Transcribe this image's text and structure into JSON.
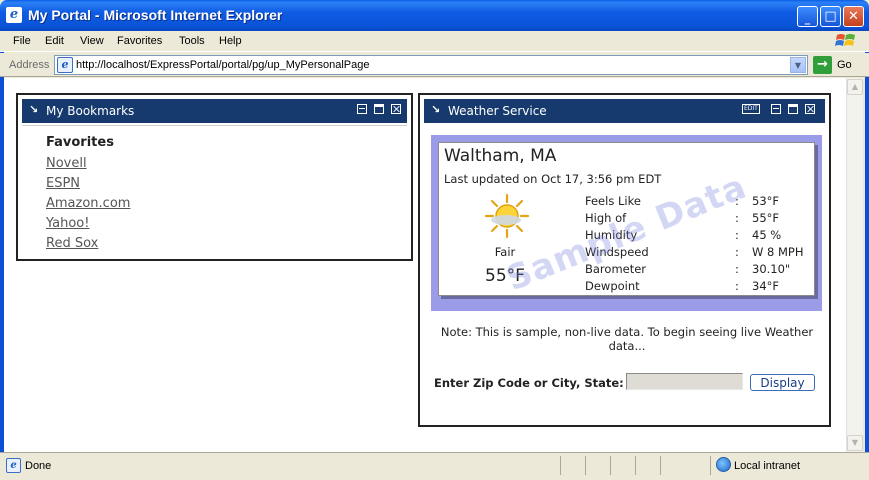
{
  "window": {
    "title": "My Portal - Microsoft Internet Explorer",
    "buttons": {
      "minimize": "—",
      "maximize": "□",
      "close": "✕"
    }
  },
  "menu": [
    "File",
    "Edit",
    "View",
    "Favorites",
    "Tools",
    "Help"
  ],
  "address": {
    "label": "Address",
    "url": "http://localhost/ExpressPortal/portal/pg/up_MyPersonalPage",
    "go_label": "Go"
  },
  "bookmarks": {
    "title": "My Bookmarks",
    "heading": "Favorites",
    "links": [
      "Novell",
      "ESPN",
      "Amazon.com",
      "Yahoo!",
      "Red Sox"
    ]
  },
  "weather": {
    "title": "Weather Service",
    "edit_label": "EDIT",
    "city": "Waltham, MA",
    "updated": "Last updated on Oct 17, 3:56 pm EDT",
    "condition": "Fair",
    "current_temp": "55°F",
    "watermark": "Sample Data",
    "rows": [
      {
        "label": "Feels Like",
        "value": "53°F"
      },
      {
        "label": "High of",
        "value": "55°F"
      },
      {
        "label": "Humidity",
        "value": "45 %"
      },
      {
        "label": "Windspeed",
        "value": "W 8 MPH"
      },
      {
        "label": "Barometer",
        "value": "30.10\""
      },
      {
        "label": "Dewpoint",
        "value": "34°F"
      }
    ],
    "separator": ":",
    "note": "Note: This is sample, non-live data. To begin seeing live Weather data...",
    "zip_label": "Enter Zip Code or City, State:",
    "zip_value": "",
    "display_button": "Display"
  },
  "status": {
    "text": "Done",
    "zone": "Local intranet"
  },
  "colors": {
    "portlet_bar": "#163a6e",
    "weather_panel": "#9b9ce8",
    "titlebar": "#0a54d9"
  },
  "icons": {
    "app": "ie-icon",
    "go": "go-arrow-icon",
    "weather": "sun-icon",
    "zone": "intranet-globe-icon"
  }
}
